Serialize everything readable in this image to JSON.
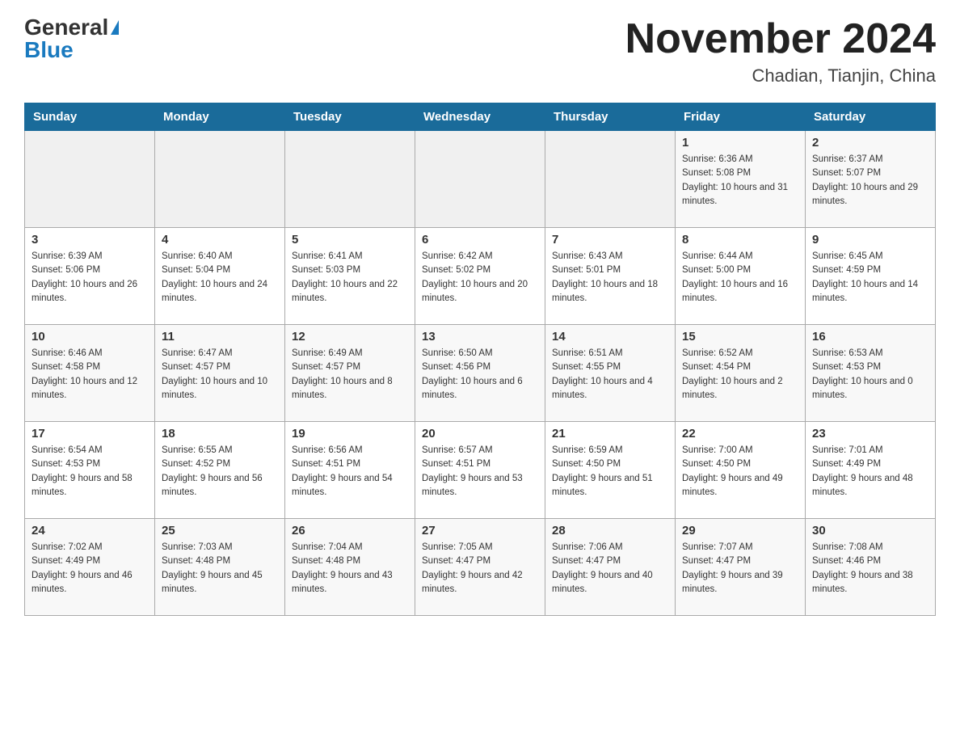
{
  "header": {
    "logo_general": "General",
    "logo_blue": "Blue",
    "month_title": "November 2024",
    "location": "Chadian, Tianjin, China"
  },
  "weekdays": [
    "Sunday",
    "Monday",
    "Tuesday",
    "Wednesday",
    "Thursday",
    "Friday",
    "Saturday"
  ],
  "weeks": [
    [
      {
        "day": "",
        "sunrise": "",
        "sunset": "",
        "daylight": ""
      },
      {
        "day": "",
        "sunrise": "",
        "sunset": "",
        "daylight": ""
      },
      {
        "day": "",
        "sunrise": "",
        "sunset": "",
        "daylight": ""
      },
      {
        "day": "",
        "sunrise": "",
        "sunset": "",
        "daylight": ""
      },
      {
        "day": "",
        "sunrise": "",
        "sunset": "",
        "daylight": ""
      },
      {
        "day": "1",
        "sunrise": "Sunrise: 6:36 AM",
        "sunset": "Sunset: 5:08 PM",
        "daylight": "Daylight: 10 hours and 31 minutes."
      },
      {
        "day": "2",
        "sunrise": "Sunrise: 6:37 AM",
        "sunset": "Sunset: 5:07 PM",
        "daylight": "Daylight: 10 hours and 29 minutes."
      }
    ],
    [
      {
        "day": "3",
        "sunrise": "Sunrise: 6:39 AM",
        "sunset": "Sunset: 5:06 PM",
        "daylight": "Daylight: 10 hours and 26 minutes."
      },
      {
        "day": "4",
        "sunrise": "Sunrise: 6:40 AM",
        "sunset": "Sunset: 5:04 PM",
        "daylight": "Daylight: 10 hours and 24 minutes."
      },
      {
        "day": "5",
        "sunrise": "Sunrise: 6:41 AM",
        "sunset": "Sunset: 5:03 PM",
        "daylight": "Daylight: 10 hours and 22 minutes."
      },
      {
        "day": "6",
        "sunrise": "Sunrise: 6:42 AM",
        "sunset": "Sunset: 5:02 PM",
        "daylight": "Daylight: 10 hours and 20 minutes."
      },
      {
        "day": "7",
        "sunrise": "Sunrise: 6:43 AM",
        "sunset": "Sunset: 5:01 PM",
        "daylight": "Daylight: 10 hours and 18 minutes."
      },
      {
        "day": "8",
        "sunrise": "Sunrise: 6:44 AM",
        "sunset": "Sunset: 5:00 PM",
        "daylight": "Daylight: 10 hours and 16 minutes."
      },
      {
        "day": "9",
        "sunrise": "Sunrise: 6:45 AM",
        "sunset": "Sunset: 4:59 PM",
        "daylight": "Daylight: 10 hours and 14 minutes."
      }
    ],
    [
      {
        "day": "10",
        "sunrise": "Sunrise: 6:46 AM",
        "sunset": "Sunset: 4:58 PM",
        "daylight": "Daylight: 10 hours and 12 minutes."
      },
      {
        "day": "11",
        "sunrise": "Sunrise: 6:47 AM",
        "sunset": "Sunset: 4:57 PM",
        "daylight": "Daylight: 10 hours and 10 minutes."
      },
      {
        "day": "12",
        "sunrise": "Sunrise: 6:49 AM",
        "sunset": "Sunset: 4:57 PM",
        "daylight": "Daylight: 10 hours and 8 minutes."
      },
      {
        "day": "13",
        "sunrise": "Sunrise: 6:50 AM",
        "sunset": "Sunset: 4:56 PM",
        "daylight": "Daylight: 10 hours and 6 minutes."
      },
      {
        "day": "14",
        "sunrise": "Sunrise: 6:51 AM",
        "sunset": "Sunset: 4:55 PM",
        "daylight": "Daylight: 10 hours and 4 minutes."
      },
      {
        "day": "15",
        "sunrise": "Sunrise: 6:52 AM",
        "sunset": "Sunset: 4:54 PM",
        "daylight": "Daylight: 10 hours and 2 minutes."
      },
      {
        "day": "16",
        "sunrise": "Sunrise: 6:53 AM",
        "sunset": "Sunset: 4:53 PM",
        "daylight": "Daylight: 10 hours and 0 minutes."
      }
    ],
    [
      {
        "day": "17",
        "sunrise": "Sunrise: 6:54 AM",
        "sunset": "Sunset: 4:53 PM",
        "daylight": "Daylight: 9 hours and 58 minutes."
      },
      {
        "day": "18",
        "sunrise": "Sunrise: 6:55 AM",
        "sunset": "Sunset: 4:52 PM",
        "daylight": "Daylight: 9 hours and 56 minutes."
      },
      {
        "day": "19",
        "sunrise": "Sunrise: 6:56 AM",
        "sunset": "Sunset: 4:51 PM",
        "daylight": "Daylight: 9 hours and 54 minutes."
      },
      {
        "day": "20",
        "sunrise": "Sunrise: 6:57 AM",
        "sunset": "Sunset: 4:51 PM",
        "daylight": "Daylight: 9 hours and 53 minutes."
      },
      {
        "day": "21",
        "sunrise": "Sunrise: 6:59 AM",
        "sunset": "Sunset: 4:50 PM",
        "daylight": "Daylight: 9 hours and 51 minutes."
      },
      {
        "day": "22",
        "sunrise": "Sunrise: 7:00 AM",
        "sunset": "Sunset: 4:50 PM",
        "daylight": "Daylight: 9 hours and 49 minutes."
      },
      {
        "day": "23",
        "sunrise": "Sunrise: 7:01 AM",
        "sunset": "Sunset: 4:49 PM",
        "daylight": "Daylight: 9 hours and 48 minutes."
      }
    ],
    [
      {
        "day": "24",
        "sunrise": "Sunrise: 7:02 AM",
        "sunset": "Sunset: 4:49 PM",
        "daylight": "Daylight: 9 hours and 46 minutes."
      },
      {
        "day": "25",
        "sunrise": "Sunrise: 7:03 AM",
        "sunset": "Sunset: 4:48 PM",
        "daylight": "Daylight: 9 hours and 45 minutes."
      },
      {
        "day": "26",
        "sunrise": "Sunrise: 7:04 AM",
        "sunset": "Sunset: 4:48 PM",
        "daylight": "Daylight: 9 hours and 43 minutes."
      },
      {
        "day": "27",
        "sunrise": "Sunrise: 7:05 AM",
        "sunset": "Sunset: 4:47 PM",
        "daylight": "Daylight: 9 hours and 42 minutes."
      },
      {
        "day": "28",
        "sunrise": "Sunrise: 7:06 AM",
        "sunset": "Sunset: 4:47 PM",
        "daylight": "Daylight: 9 hours and 40 minutes."
      },
      {
        "day": "29",
        "sunrise": "Sunrise: 7:07 AM",
        "sunset": "Sunset: 4:47 PM",
        "daylight": "Daylight: 9 hours and 39 minutes."
      },
      {
        "day": "30",
        "sunrise": "Sunrise: 7:08 AM",
        "sunset": "Sunset: 4:46 PM",
        "daylight": "Daylight: 9 hours and 38 minutes."
      }
    ]
  ]
}
